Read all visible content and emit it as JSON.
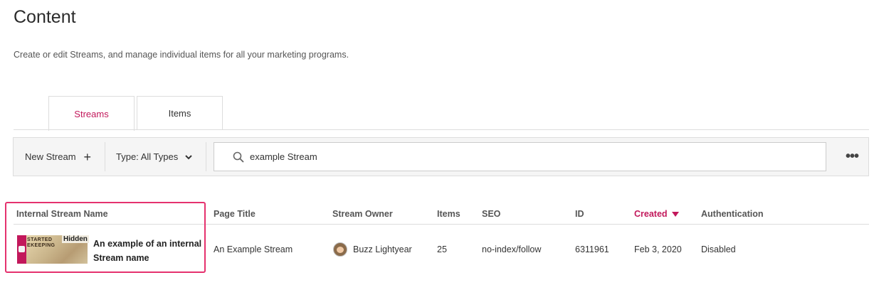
{
  "page": {
    "title": "Content",
    "description": "Create or edit Streams, and manage individual items for all your marketing programs."
  },
  "tabs": [
    {
      "label": "Streams",
      "active": true
    },
    {
      "label": "Items",
      "active": false
    }
  ],
  "toolbar": {
    "new_stream_label": "New Stream",
    "new_stream_icon": "plus-icon",
    "type_filter_label": "Type: All Types",
    "search_value": "example Stream",
    "search_icon": "search-icon",
    "more_icon": "more-options-icon"
  },
  "table": {
    "columns": {
      "internal_name": "Internal Stream Name",
      "page_title": "Page Title",
      "owner": "Stream Owner",
      "items": "Items",
      "seo": "SEO",
      "id": "ID",
      "created": "Created",
      "authentication": "Authentication"
    },
    "sorted_column": "Created",
    "sort_direction": "descending",
    "rows": [
      {
        "thumbnail_text_line1": "STARTED",
        "thumbnail_text_line2": "EKEEPING",
        "visibility_badge": "Hidden",
        "internal_name": "An example of an internal Stream name",
        "page_title": "An Example Stream",
        "owner": "Buzz Lightyear",
        "items": "25",
        "seo": "no-index/follow",
        "id": "6311961",
        "created": "Feb 3, 2020",
        "authentication": "Disabled"
      }
    ]
  },
  "colors": {
    "accent": "#c2185b",
    "highlight_border": "#e5316e"
  }
}
